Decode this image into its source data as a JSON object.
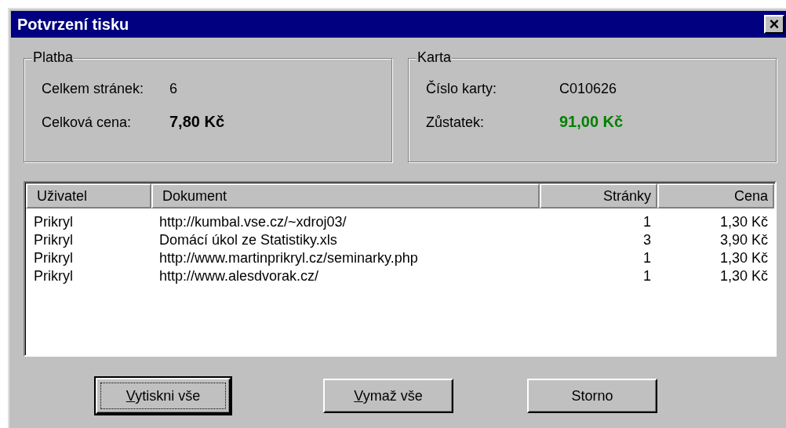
{
  "window": {
    "title": "Potvrzení tisku",
    "close": "×"
  },
  "payment": {
    "legend": "Platba",
    "rows": [
      {
        "label": "Celkem stránek:",
        "value": "6",
        "emphasis": false,
        "color": "#000000"
      },
      {
        "label": "Celková cena:",
        "value": "7,80 Kč",
        "emphasis": true,
        "color": "#000000"
      }
    ]
  },
  "card": {
    "legend": "Karta",
    "rows": [
      {
        "label": "Číslo karty:",
        "value": "C010626",
        "emphasis": false,
        "color": "#000000"
      },
      {
        "label": "Zůstatek:",
        "value": "91,00 Kč",
        "emphasis": true,
        "color": "#008000"
      }
    ]
  },
  "table": {
    "columns": [
      {
        "label": "Uživatel",
        "numeric": false
      },
      {
        "label": "Dokument",
        "numeric": false
      },
      {
        "label": "Stránky",
        "numeric": true
      },
      {
        "label": "Cena",
        "numeric": true
      }
    ],
    "rows": [
      [
        "Prikryl",
        "http://kumbal.vse.cz/~xdroj03/",
        "1",
        "1,30 Kč"
      ],
      [
        "Prikryl",
        "Domácí úkol ze Statistiky.xls",
        "3",
        "3,90 Kč"
      ],
      [
        "Prikryl",
        "http://www.martinprikryl.cz/seminarky.php",
        "1",
        "1,30 Kč"
      ],
      [
        "Prikryl",
        "http://www.alesdvorak.cz/",
        "1",
        "1,30 Kč"
      ]
    ]
  },
  "buttons": [
    {
      "label": "Vytiskni vše",
      "mnemonic_first": true,
      "default": true
    },
    {
      "label": "Vymaž vše",
      "mnemonic_first": true,
      "default": false
    },
    {
      "label": "Storno",
      "mnemonic_first": false,
      "default": false
    }
  ]
}
